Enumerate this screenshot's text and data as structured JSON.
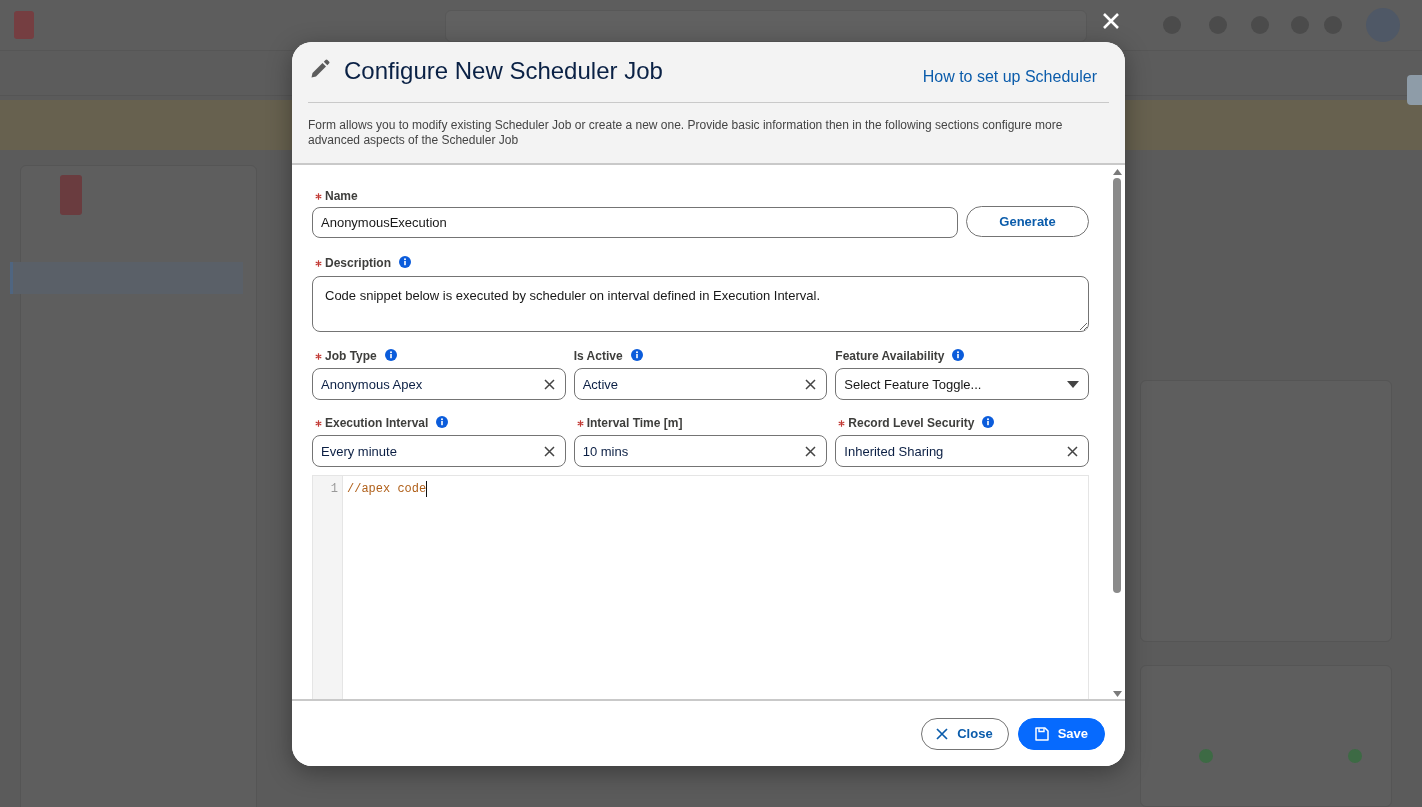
{
  "dialog": {
    "title": "Configure New Scheduler Job",
    "help_link": "How to set up Scheduler",
    "intro": "Form allows you to modify existing Scheduler Job or create a new one. Provide basic information then in the following sections configure more advanced aspects of the Scheduler Job"
  },
  "name_field": {
    "label": "Name",
    "required": true,
    "info": false,
    "value": "AnonymousExecution",
    "action": "Generate"
  },
  "description_field": {
    "label": "Description",
    "required": true,
    "info": true,
    "value": "Code snippet below is executed by scheduler on interval defined in Execution Interval."
  },
  "field_rows": [
    [
      {
        "kind": "combobox",
        "label": "Job Type",
        "required": true,
        "info": true,
        "value": "Anonymous Apex"
      },
      {
        "kind": "combobox",
        "label": "Is Active",
        "required": false,
        "info": true,
        "value": "Active"
      },
      {
        "kind": "select",
        "label": "Feature Availability",
        "required": false,
        "info": true,
        "placeholder": "Select Feature Toggle..."
      }
    ],
    [
      {
        "kind": "combobox",
        "label": "Execution Interval",
        "required": true,
        "info": true,
        "value": "Every minute"
      },
      {
        "kind": "combobox",
        "label": "Interval Time [m]",
        "required": true,
        "info": false,
        "value": "10 mins"
      },
      {
        "kind": "combobox",
        "label": "Record Level Security",
        "required": true,
        "info": true,
        "value": "Inherited Sharing"
      }
    ]
  ],
  "code_editor": {
    "lines": [
      {
        "number": "1",
        "code": "//apex code"
      }
    ]
  },
  "footer_buttons": [
    {
      "kind": "close",
      "label": "Close"
    },
    {
      "kind": "save",
      "label": "Save"
    }
  ]
}
